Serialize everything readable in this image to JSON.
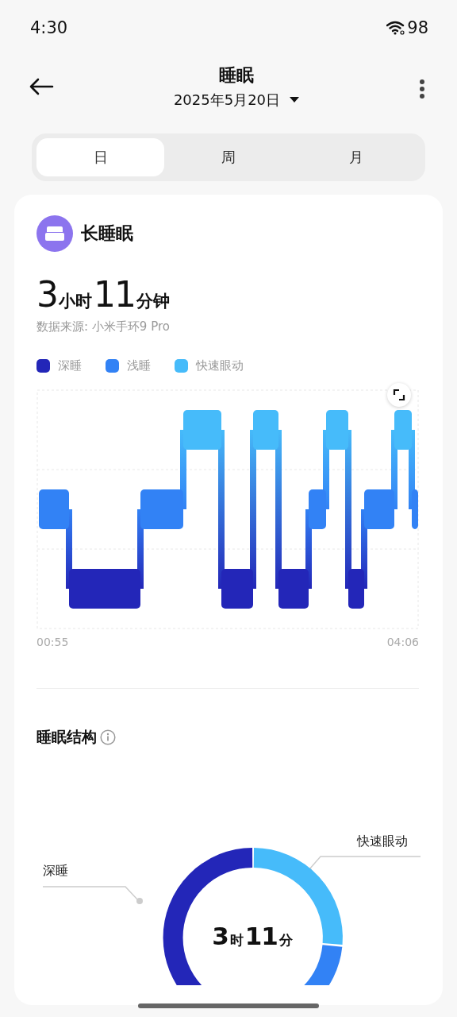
{
  "status_bar": {
    "time": "4:30",
    "battery": "98"
  },
  "header": {
    "title": "睡眠",
    "date": "2025年5月20日"
  },
  "tabs": [
    {
      "label": "日",
      "selected": true
    },
    {
      "label": "周",
      "selected": false
    },
    {
      "label": "月",
      "selected": false
    }
  ],
  "card": {
    "title": "长睡眠",
    "duration": [
      {
        "value": "3",
        "unit": "小时"
      },
      {
        "value": "11",
        "unit": "分钟"
      }
    ],
    "source": "数据来源: 小米手环9 Pro",
    "legend": [
      {
        "label": "深睡",
        "color": "#2326b8"
      },
      {
        "label": "浅睡",
        "color": "#3282f5"
      },
      {
        "label": "快速眼动",
        "color": "#46bbfa"
      }
    ],
    "chart_start": "00:55",
    "chart_end": "04:06"
  },
  "structure": {
    "title": "睡眠结构",
    "center": [
      {
        "value": "3",
        "unit": "时"
      },
      {
        "value": "11",
        "unit": "分"
      }
    ],
    "labels": [
      {
        "label": "深睡"
      },
      {
        "label": "快速眼动"
      }
    ]
  }
}
